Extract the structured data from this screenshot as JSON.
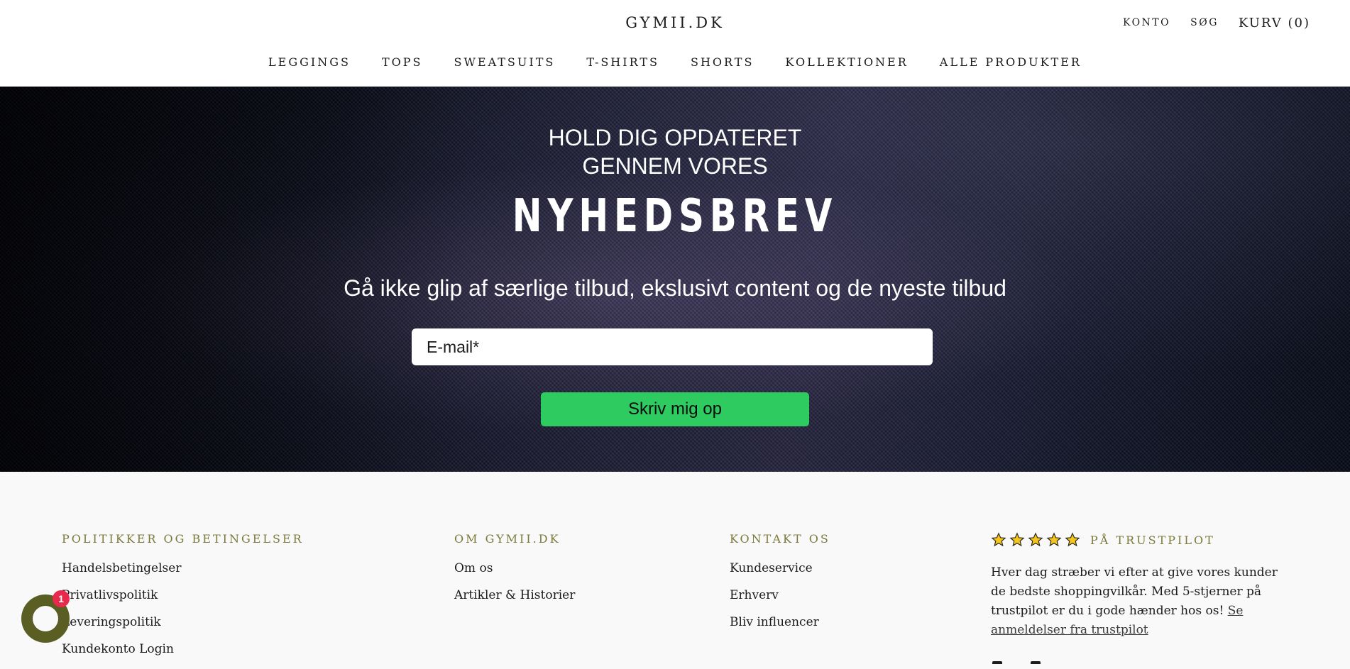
{
  "header": {
    "logo": "GYMII.DK",
    "secondary_nav": {
      "account": "KONTO",
      "search": "SØG",
      "cart": "KURV (0)"
    },
    "main_nav": [
      "LEGGINGS",
      "TOPS",
      "SWEATSUITS",
      "T-SHIRTS",
      "SHORTS",
      "KOLLEKTIONER",
      "ALLE PRODUKTER"
    ]
  },
  "newsletter": {
    "line1": "HOLD DIG OPDATERET",
    "line2": "GENNEM VORES",
    "title": "NYHEDSBREV",
    "subtitle": "Gå ikke glip af særlige tilbud, ekslusivt content og de nyeste tilbud",
    "email_placeholder": "E-mail*",
    "submit_label": "Skriv mig op",
    "button_color": "#2ecc60"
  },
  "footer": {
    "policies": {
      "heading": "POLITIKKER OG BETINGELSER",
      "links": [
        "Handelsbetingelser",
        "Privatlivspolitik",
        "Leveringspolitik",
        "Kundekonto Login"
      ]
    },
    "about": {
      "heading": "OM GYMII.DK",
      "links": [
        "Om os",
        "Artikler & Historier"
      ]
    },
    "contact": {
      "heading": "KONTAKT OS",
      "links": [
        "Kundeservice",
        "Erhverv",
        "Bliv influencer"
      ]
    },
    "trustpilot": {
      "heading": "PÅ TRUSTPILOT",
      "stars": 5,
      "text": "Hver dag stræber vi efter at give vores kunder de bedste shoppingvilkår. Med 5-stjerner på trustpilot er du i gode hænder hos os!",
      "link": "Se anmeldelser fra trustpilot",
      "heading_color": "#7b7a3a"
    }
  },
  "chat": {
    "badge_count": "1",
    "icon": "chat-icon",
    "color": "#5b5e22"
  }
}
